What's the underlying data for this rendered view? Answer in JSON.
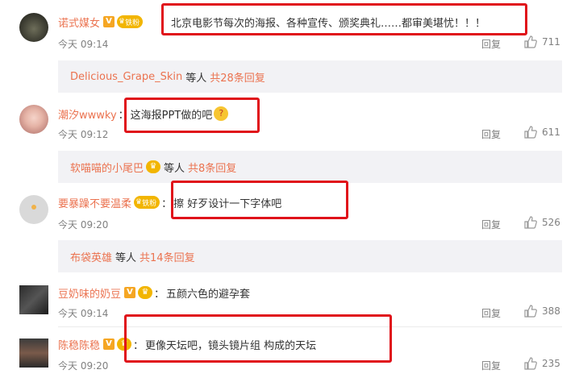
{
  "comments": [
    {
      "user": "诺式媒女",
      "has_v": true,
      "fan_label": "铁粉",
      "colon": "",
      "text": "北京电影节每次的海报、各种宣传、颁奖典礼……都审美堪忧！！！",
      "time": "今天 09:14",
      "reply_label": "回复",
      "likes": "711",
      "sub": {
        "user": "Delicious_Grape_Skin",
        "mid": "等人",
        "count": "共28条回复"
      }
    },
    {
      "user": "潮汐wwwky",
      "has_v": false,
      "colon": "：",
      "text": "这海报PPT做的吧",
      "time": "今天 09:12",
      "reply_label": "回复",
      "likes": "611",
      "sub": {
        "user": "软喵喵的小尾巴",
        "mid": "等人",
        "count": "共8条回复"
      }
    },
    {
      "user": "要暴躁不要温柔",
      "has_v": false,
      "fan_label": "铁粉",
      "colon": "：",
      "text": "擦 好歹设计一下字体吧",
      "time": "今天 09:20",
      "reply_label": "回复",
      "likes": "526",
      "sub": {
        "user": "布袋英雄",
        "mid": "等人",
        "count": "共14条回复"
      }
    },
    {
      "user": "豆奶味的奶豆",
      "has_v": true,
      "colon": "：",
      "text": "五颜六色的避孕套",
      "time": "今天 09:14",
      "reply_label": "回复",
      "likes": "388"
    },
    {
      "user": "陈稳陈稳",
      "has_v": true,
      "colon": "：",
      "text": "更像天坛吧，镜头镜片组 构成的天坛",
      "time": "今天 09:20",
      "reply_label": "回复",
      "likes": "235"
    }
  ],
  "colors": {
    "username": "#eb7350",
    "highlight": "#e0121a",
    "subbox": "#f2f2f5"
  }
}
